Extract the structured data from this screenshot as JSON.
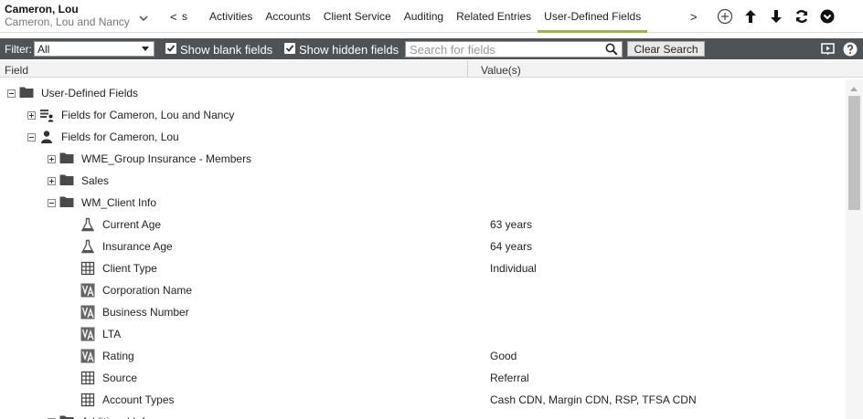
{
  "contact": {
    "name": "Cameron, Lou",
    "household": "Cameron, Lou and Nancy"
  },
  "nav": {
    "prev_label": "<",
    "prev_tab_fragment": "s",
    "next_label": ">",
    "tabs": [
      {
        "label": "Activities"
      },
      {
        "label": "Accounts"
      },
      {
        "label": "Client Service"
      },
      {
        "label": "Auditing"
      },
      {
        "label": "Related Entries"
      },
      {
        "label": "User-Defined Fields",
        "active": true
      }
    ],
    "accent_color": "#8fc31f"
  },
  "toolbar_icons": [
    "add-circle-icon",
    "arrow-up-icon",
    "arrow-down-icon",
    "refresh-icon",
    "chevron-down-circle-icon"
  ],
  "filterbar": {
    "filter_label": "Filter:",
    "filter_value": "All",
    "show_blank_label": "Show blank fields",
    "show_blank_checked": true,
    "show_hidden_label": "Show hidden fields",
    "show_hidden_checked": true,
    "search_placeholder": "Search for fields",
    "search_value": "",
    "clear_label": "Clear Search",
    "background_color": "#4e5358"
  },
  "columns": {
    "field": "Field",
    "values": "Value(s)"
  },
  "tree": [
    {
      "level": 0,
      "toggle": "minus",
      "icon": "folder-icon",
      "label": "User-Defined Fields",
      "value": ""
    },
    {
      "level": 1,
      "toggle": "plus",
      "icon": "household-icon",
      "label": "Fields for Cameron, Lou and Nancy",
      "value": ""
    },
    {
      "level": 1,
      "toggle": "minus",
      "icon": "person-icon",
      "label": "Fields for Cameron, Lou",
      "value": ""
    },
    {
      "level": 2,
      "toggle": "plus",
      "icon": "folder-icon",
      "label": "WME_Group Insurance - Members",
      "value": ""
    },
    {
      "level": 2,
      "toggle": "plus",
      "icon": "folder-icon",
      "label": "Sales",
      "value": ""
    },
    {
      "level": 2,
      "toggle": "minus",
      "icon": "folder-icon",
      "label": "WM_Client Info",
      "value": ""
    },
    {
      "level": 3,
      "toggle": "none",
      "icon": "flask-icon",
      "label": "Current Age",
      "value": "63 years"
    },
    {
      "level": 3,
      "toggle": "none",
      "icon": "flask-icon",
      "label": "Insurance Age",
      "value": "64 years"
    },
    {
      "level": 3,
      "toggle": "none",
      "icon": "grid-icon",
      "label": "Client Type",
      "value": "Individual"
    },
    {
      "level": 3,
      "toggle": "none",
      "icon": "text-field-icon",
      "label": "Corporation Name",
      "value": ""
    },
    {
      "level": 3,
      "toggle": "none",
      "icon": "text-field-icon",
      "label": "Business Number",
      "value": ""
    },
    {
      "level": 3,
      "toggle": "none",
      "icon": "text-field-icon",
      "label": "LTA",
      "value": ""
    },
    {
      "level": 3,
      "toggle": "none",
      "icon": "text-field-icon",
      "label": "Rating",
      "value": "Good"
    },
    {
      "level": 3,
      "toggle": "none",
      "icon": "grid-icon",
      "label": "Source",
      "value": "Referral"
    },
    {
      "level": 3,
      "toggle": "none",
      "icon": "grid-icon",
      "label": "Account Types",
      "value": "Cash CDN, Margin CDN, RSP, TFSA CDN"
    },
    {
      "level": 2,
      "toggle": "plus",
      "icon": "folder-icon",
      "label": "Additional Info",
      "value": ""
    }
  ]
}
